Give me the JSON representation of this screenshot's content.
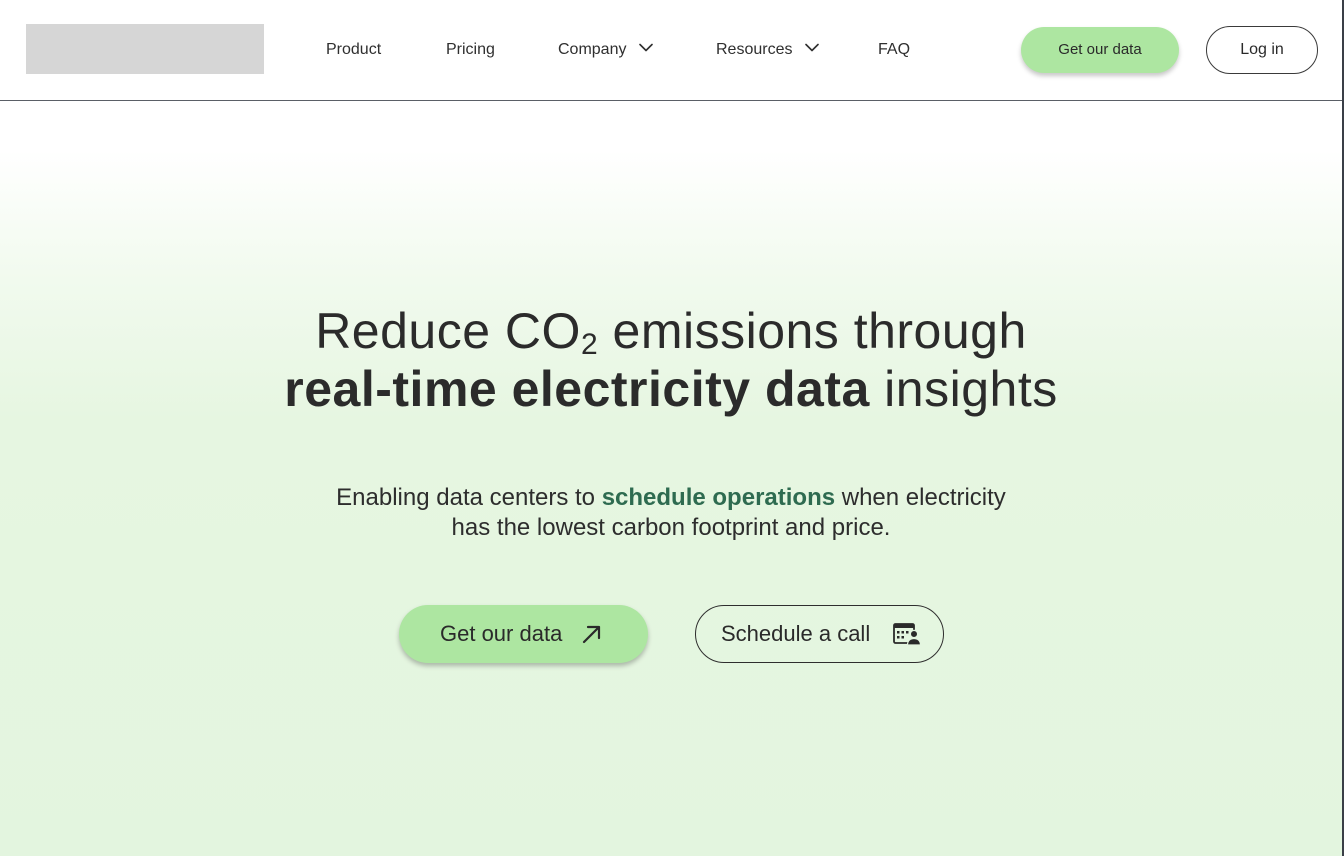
{
  "header": {
    "nav": {
      "product": "Product",
      "pricing": "Pricing",
      "company": "Company",
      "resources": "Resources",
      "faq": "FAQ"
    },
    "get_data_label": "Get our data",
    "login_label": "Log in"
  },
  "hero": {
    "title_line1_part1": "Reduce CO",
    "title_line1_sub": "2",
    "title_line1_part2": " emissions through",
    "title_line2_bold": "real-time electricity data",
    "title_line2_rest": " insights",
    "subtitle_part1": "Enabling data centers to ",
    "subtitle_emphasis": "schedule operations",
    "subtitle_part2": " when electricity",
    "subtitle_line2": "has the lowest carbon footprint and price.",
    "cta_primary_label": "Get our data",
    "cta_secondary_label": "Schedule a call"
  },
  "icons": {
    "primary_cta": "arrow-up-right-icon",
    "secondary_cta": "calendar-person-icon",
    "dropdown": "chevron-down-icon"
  },
  "colors": {
    "accent_green": "#ade6a1",
    "emphasis_text": "#2e6b50"
  }
}
